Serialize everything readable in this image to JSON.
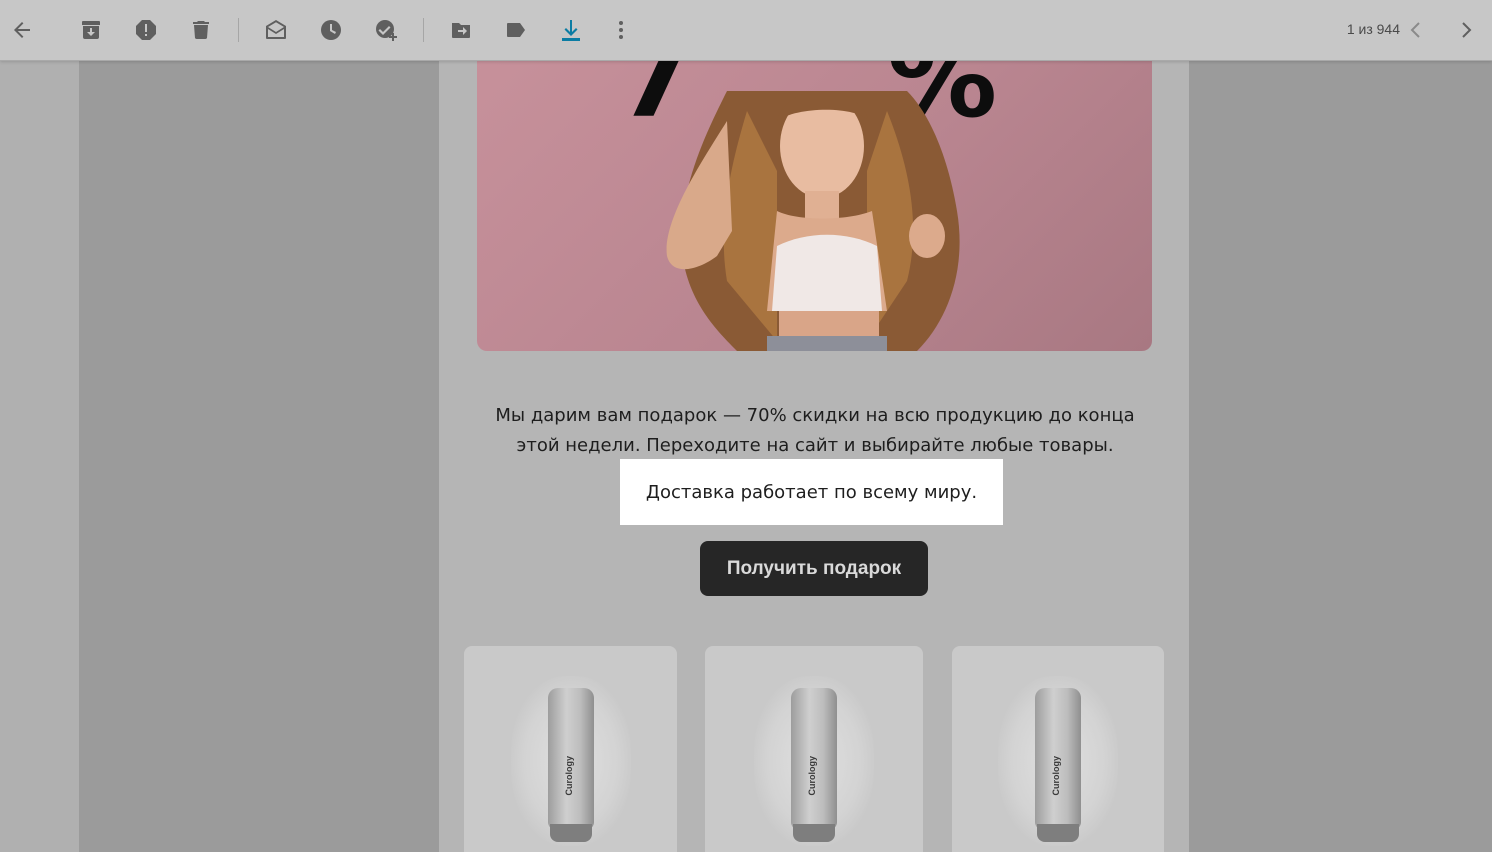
{
  "toolbar": {
    "buttons": [
      {
        "name": "back-arrow-icon"
      },
      {
        "name": "archive-icon"
      },
      {
        "name": "report-spam-icon"
      },
      {
        "name": "delete-icon"
      },
      {
        "name": "mark-unread-icon"
      },
      {
        "name": "snooze-icon"
      },
      {
        "name": "add-task-icon"
      },
      {
        "name": "move-to-icon"
      },
      {
        "name": "label-icon"
      },
      {
        "name": "download-icon"
      },
      {
        "name": "more-vert-icon"
      }
    ],
    "pager_text": "1 из 944",
    "accent_color": "#0b7ca3"
  },
  "email": {
    "hero_text_left": "7",
    "hero_text_right": "%",
    "body_text": "Мы дарим вам подарок — 70% скидки на всю продукцию до конца этой недели. Переходите на сайт и выбирайте любые товары.",
    "highlight_text": "Доставка работает по всему миру.",
    "cta_label": "Получить подарок",
    "products": [
      {
        "brand": "Curology"
      },
      {
        "brand": "Curology"
      },
      {
        "brand": "Curology"
      }
    ]
  }
}
